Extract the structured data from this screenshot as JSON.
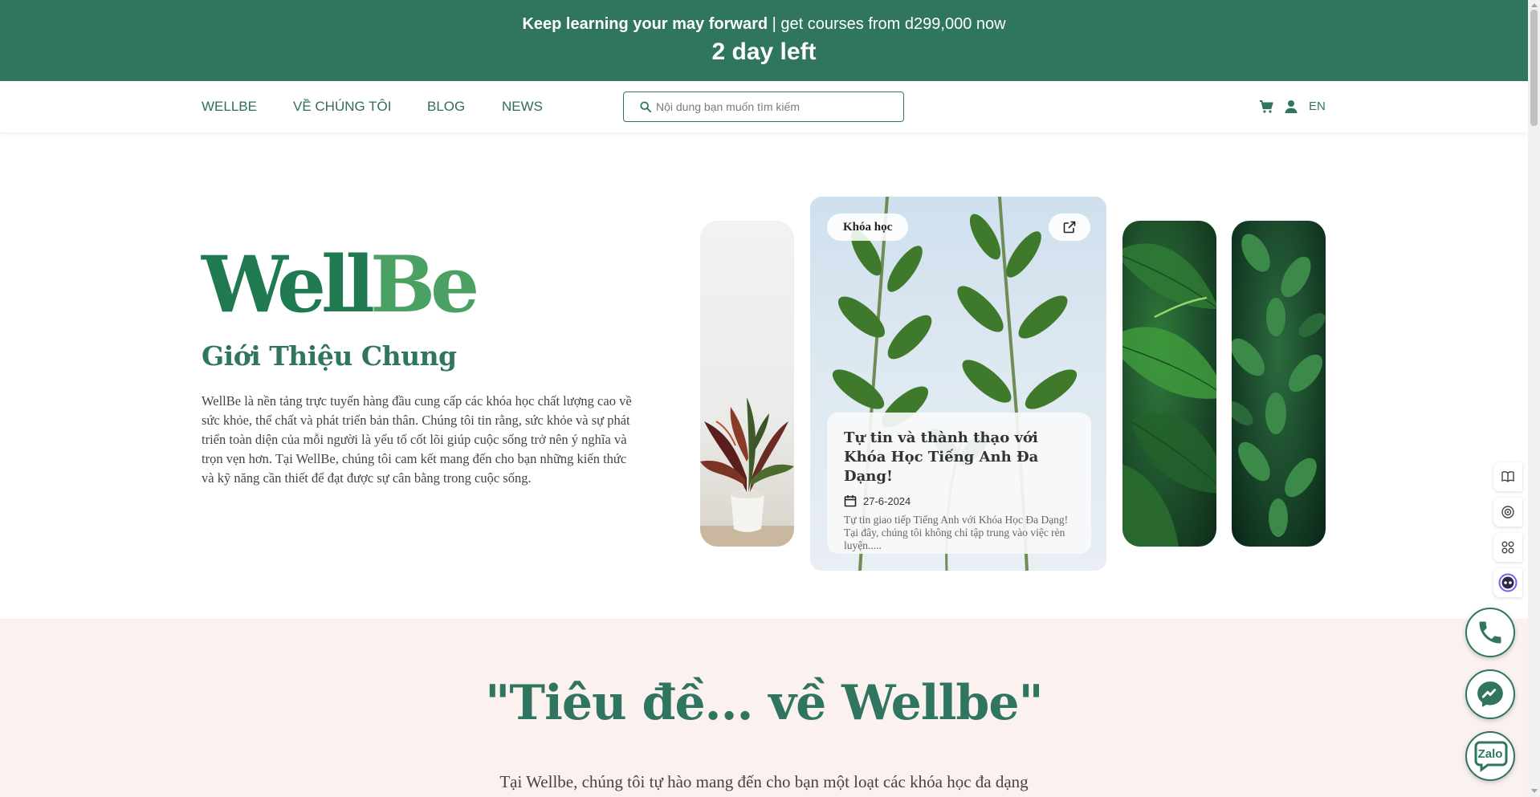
{
  "promo": {
    "highlight": "Keep learning your may forward",
    "separator": " | ",
    "rest": "get courses from d299,000 now",
    "countdown": "2 day left"
  },
  "nav": {
    "links": [
      "WELLBE",
      "VỀ CHÚNG TÔI",
      "BLOG",
      "NEWS"
    ],
    "search_placeholder": "Nội dung bạn muốn tìm kiếm",
    "lang": "EN"
  },
  "hero": {
    "logo_part1": "Well",
    "logo_part2": "Be",
    "title": "Giới Thiệu Chung",
    "description": "WellBe là nền tảng trực tuyến hàng đầu cung cấp các khóa học chất lượng cao về sức khỏe, thể chất và phát triển bản thân. Chúng tôi tin rằng, sức khỏe và sự phát triển toàn diện của mỗi người là yếu tố cốt lõi giúp cuộc sống trở nên ý nghĩa và trọn vẹn hơn. Tại WellBe, chúng tôi cam kết mang đến cho bạn những kiến thức và kỹ năng cần thiết để đạt được sự cân bằng trong cuộc sống."
  },
  "featured_card": {
    "tag": "Khóa học",
    "title": "Tự tin và thành thạo với Khóa Học Tiếng Anh Đa Dạng!",
    "date": "27-6-2024",
    "excerpt": "Tự tin giao tiếp Tiếng Anh với Khóa Học Đa Dạng! Tại đây, chúng tôi không chỉ tập trung vào việc rèn luyện....."
  },
  "about": {
    "title": "\"Tiêu đề... về Wellbe\"",
    "description": "Tại Wellbe, chúng tôi tự hào mang đến cho bạn một loạt các khóa học đa dạng"
  },
  "floating": {
    "zalo_label": "Zalo"
  },
  "colors": {
    "brand_green": "#2f7560",
    "logo_dark": "#1f7a52",
    "logo_light": "#4aa163",
    "section_bg": "#fbf2ef"
  },
  "icons": [
    "search-icon",
    "cart-icon",
    "user-icon",
    "external-link-icon",
    "calendar-icon",
    "book-icon",
    "podcast-icon",
    "apps-icon",
    "bot-icon",
    "phone-icon",
    "messenger-icon",
    "zalo-icon"
  ]
}
